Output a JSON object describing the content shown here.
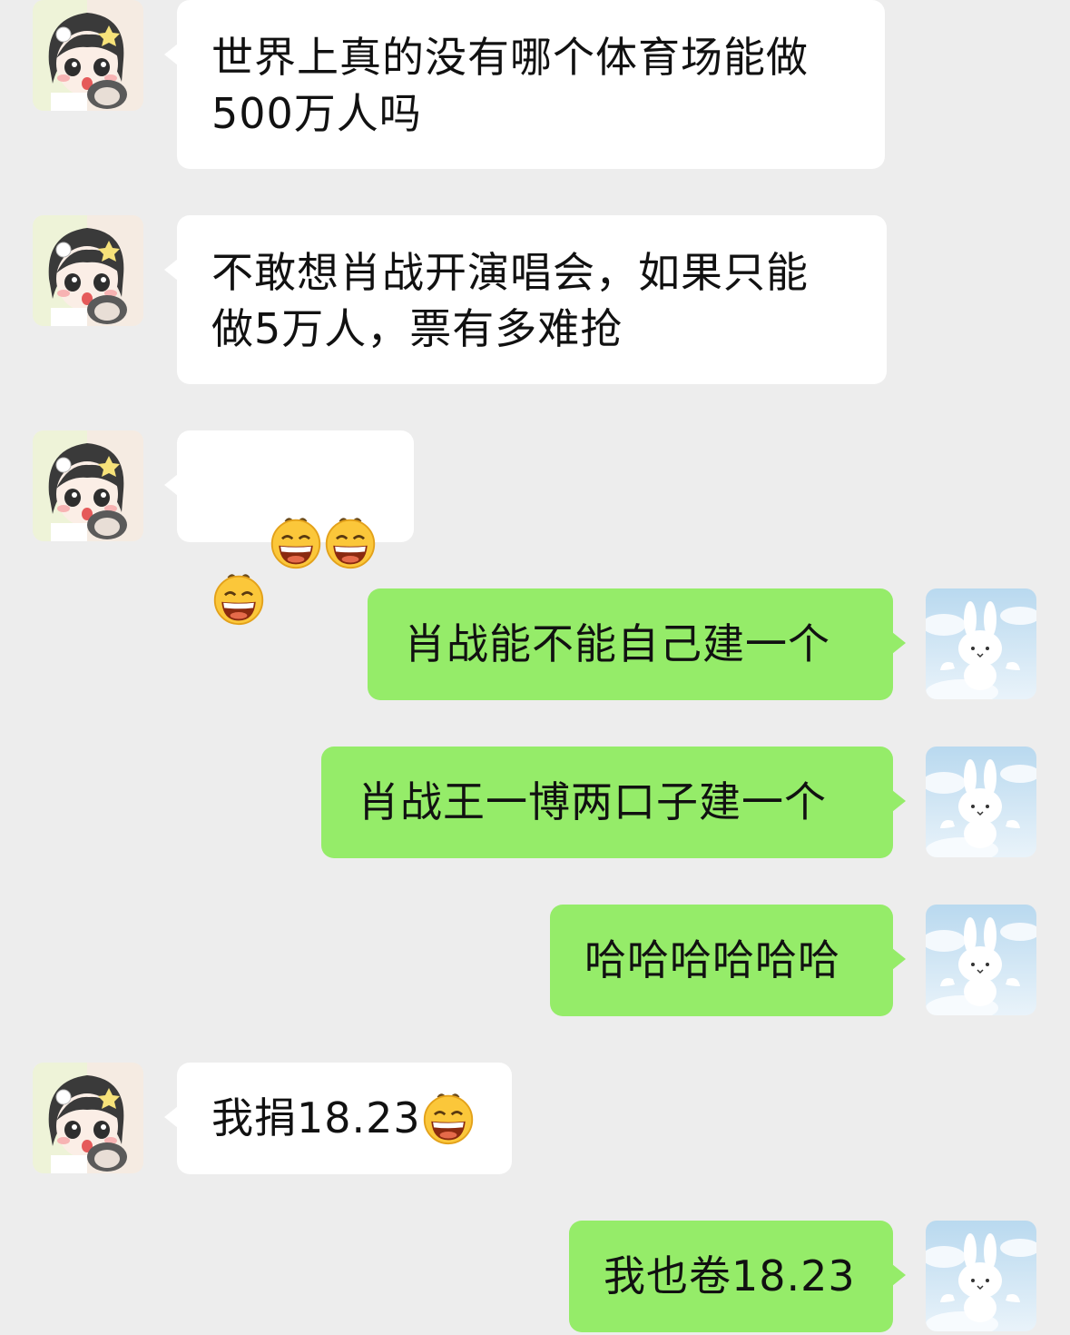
{
  "colors": {
    "background": "#ededed",
    "incoming_bubble": "#ffffff",
    "outgoing_bubble": "#95ec69",
    "text": "#111111"
  },
  "messages": [
    {
      "from": "other",
      "text": "世界上真的没有哪个体育场能做\n500万人吗"
    },
    {
      "from": "other",
      "text": "不敢想肖战开演唱会，如果只能\n做5万人，票有多难抢"
    },
    {
      "from": "other",
      "text": "",
      "emojis": [
        "grin-emoji",
        "grin-emoji",
        "grin-emoji"
      ]
    },
    {
      "from": "me",
      "text": "肖战能不能自己建一个"
    },
    {
      "from": "me",
      "text": "肖战王一博两口子建一个"
    },
    {
      "from": "me",
      "text": "哈哈哈哈哈哈"
    },
    {
      "from": "other",
      "text": "我捐18.23",
      "emojis": [
        "grin-emoji"
      ]
    },
    {
      "from": "me",
      "text": "我也卷18.23"
    }
  ],
  "avatars": {
    "other": "anime-girl-avatar",
    "me": "white-bunny-avatar"
  }
}
